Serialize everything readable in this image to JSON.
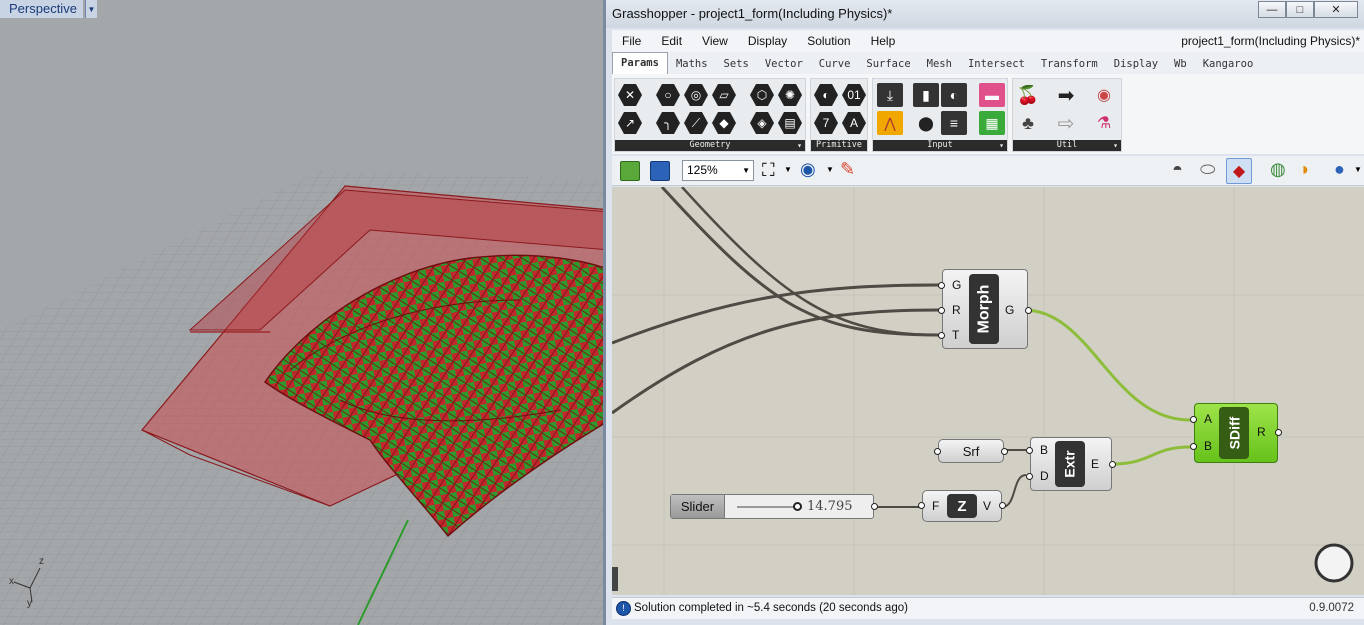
{
  "viewport": {
    "name": "Perspective",
    "axes": {
      "x": "x",
      "y": "y",
      "z": "z"
    }
  },
  "window": {
    "title": "Grasshopper - project1_form(Including Physics)*",
    "controls": {
      "minimize": "—",
      "maximize": "□",
      "close": "✕"
    }
  },
  "menu": {
    "items": [
      "File",
      "Edit",
      "View",
      "Display",
      "Solution",
      "Help"
    ],
    "document_name": "project1_form(Including Physics)*"
  },
  "tabs": [
    "Params",
    "Maths",
    "Sets",
    "Vector",
    "Curve",
    "Surface",
    "Mesh",
    "Intersect",
    "Transform",
    "Display",
    "Wb",
    "Kangaroo"
  ],
  "ribbon": {
    "groups": [
      "Geometry",
      "Primitive",
      "Input",
      "Util"
    ],
    "expand_glyph": "▾"
  },
  "toolbar": {
    "zoom": "125%"
  },
  "components": {
    "morph": {
      "label": "Morph",
      "inputs": [
        "G",
        "R",
        "T"
      ],
      "outputs": [
        "G"
      ]
    },
    "sdiff": {
      "label": "SDiff",
      "inputs": [
        "A",
        "B"
      ],
      "outputs": [
        "R"
      ]
    },
    "srf": {
      "label": "Srf"
    },
    "extr": {
      "label": "Extr",
      "inputs": [
        "B",
        "D"
      ],
      "outputs": [
        "E"
      ]
    },
    "slider": {
      "label": "Slider",
      "value": "14.795"
    },
    "unitz": {
      "label": "Z",
      "inputs": [
        "F"
      ],
      "outputs": [
        "V"
      ]
    }
  },
  "status": {
    "message": "Solution completed in ~5.4 seconds (20 seconds ago)",
    "version": "0.9.0072",
    "icon": "info-icon"
  },
  "colors": {
    "selected_green": "#7fd321",
    "wire": "#4e4a44",
    "wire_selected": "#8ebd3c",
    "viewport_red": "#c0282d",
    "mesh_green": "#2c9b2c"
  }
}
